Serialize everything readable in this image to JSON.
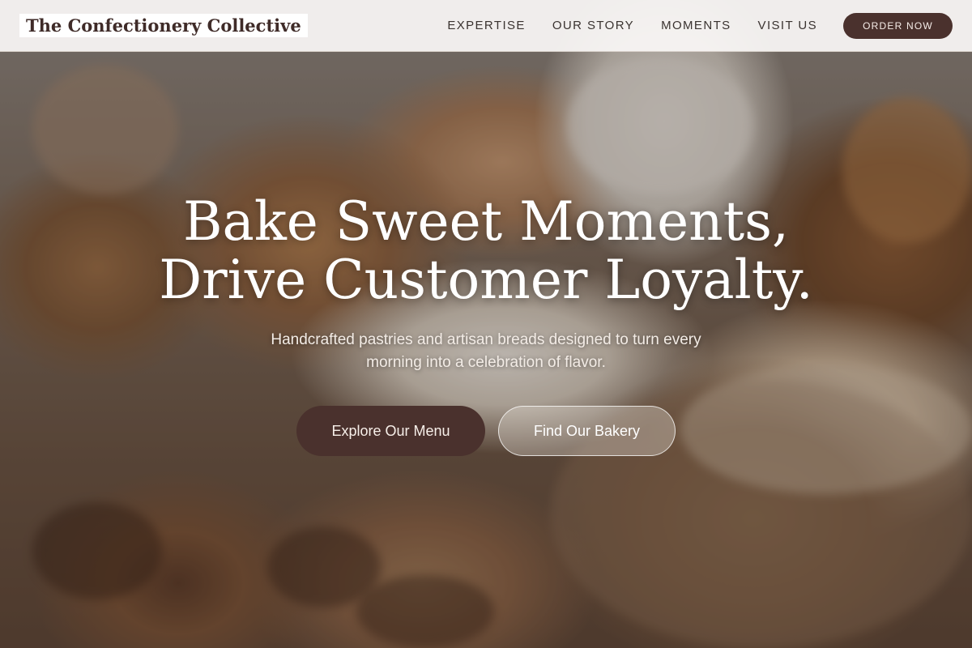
{
  "header": {
    "brand": "The Confectionery Collective",
    "nav": [
      {
        "label": "EXPERTISE"
      },
      {
        "label": "OUR STORY"
      },
      {
        "label": "MOMENTS"
      },
      {
        "label": "VISIT US"
      }
    ],
    "cta_label": "ORDER NOW"
  },
  "hero": {
    "title_line1": "Bake Sweet Moments,",
    "title_line2": "Drive Customer Loyalty.",
    "subtitle": "Handcrafted pastries and artisan breads designed to turn every morning into a celebration of flavor.",
    "primary_button": "Explore Our Menu",
    "secondary_button": "Find Our Bakery",
    "background_image": "pastry-display-photo"
  },
  "colors": {
    "accent": "#4a312d",
    "header_bg": "#faf8f6",
    "text_light": "#ffffff"
  }
}
